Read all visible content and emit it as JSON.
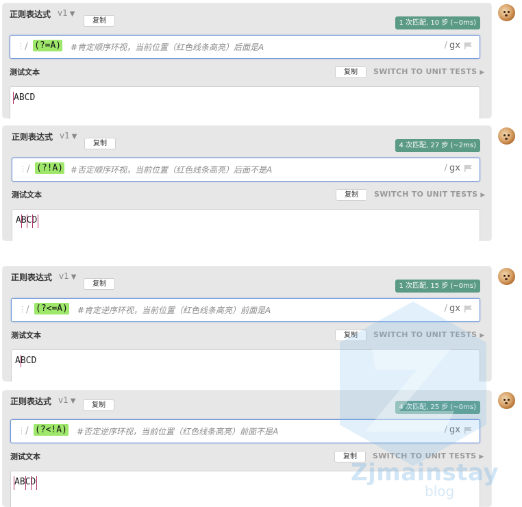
{
  "panels": [
    {
      "regex_label": "正则表达式",
      "version": "v1",
      "copy_label": "复制",
      "match_info": "1 次匹配, 10 步 (~0ms)",
      "expression": "(?=A)",
      "comment": "#肯定顺序环视，当前位置（红色线条高亮）后面是A",
      "flags": "gx",
      "test_label": "测试文本",
      "test_copy_label": "复制",
      "unit_tests_label": "SWITCH TO UNIT TESTS",
      "test_text": "ABCD"
    },
    {
      "regex_label": "正则表达式",
      "version": "v1",
      "copy_label": "复制",
      "match_info": "4 次匹配, 27 步 (~2ms)",
      "expression": "(?!A)",
      "comment": "#否定顺序环视，当前位置（红色线条高亮）后面不是A",
      "flags": "gx",
      "test_label": "测试文本",
      "test_copy_label": "复制",
      "unit_tests_label": "SWITCH TO UNIT TESTS",
      "test_text": "ABCD"
    },
    {
      "regex_label": "正则表达式",
      "version": "v1",
      "copy_label": "复制",
      "match_info": "1 次匹配, 15 步 (~0ms)",
      "expression": "(?<=A)",
      "comment": "#肯定逆序环视，当前位置（红色线条高亮）前面是A",
      "flags": "gx",
      "test_label": "测试文本",
      "test_copy_label": "复制",
      "unit_tests_label": "SWITCH TO UNIT TESTS",
      "test_text": "ABCD"
    },
    {
      "regex_label": "正则表达式",
      "version": "v1",
      "copy_label": "复制",
      "match_info": "4 次匹配, 25 步 (~0ms)",
      "expression": "(?<!A)",
      "comment": "#否定逆序环视，当前位置（红色线条高亮）前面不是A",
      "flags": "gx",
      "test_label": "测试文本",
      "test_copy_label": "复制",
      "unit_tests_label": "SWITCH TO UNIT TESTS",
      "test_text": "ABCD"
    }
  ],
  "watermark": {
    "text": "Zjmainstay",
    "sub": "blog"
  },
  "colors": {
    "match_badge": "#5b9a84",
    "expression_highlight": "#9ee76b",
    "cursor": "#b3306a",
    "focus_border": "#6a90d6"
  }
}
